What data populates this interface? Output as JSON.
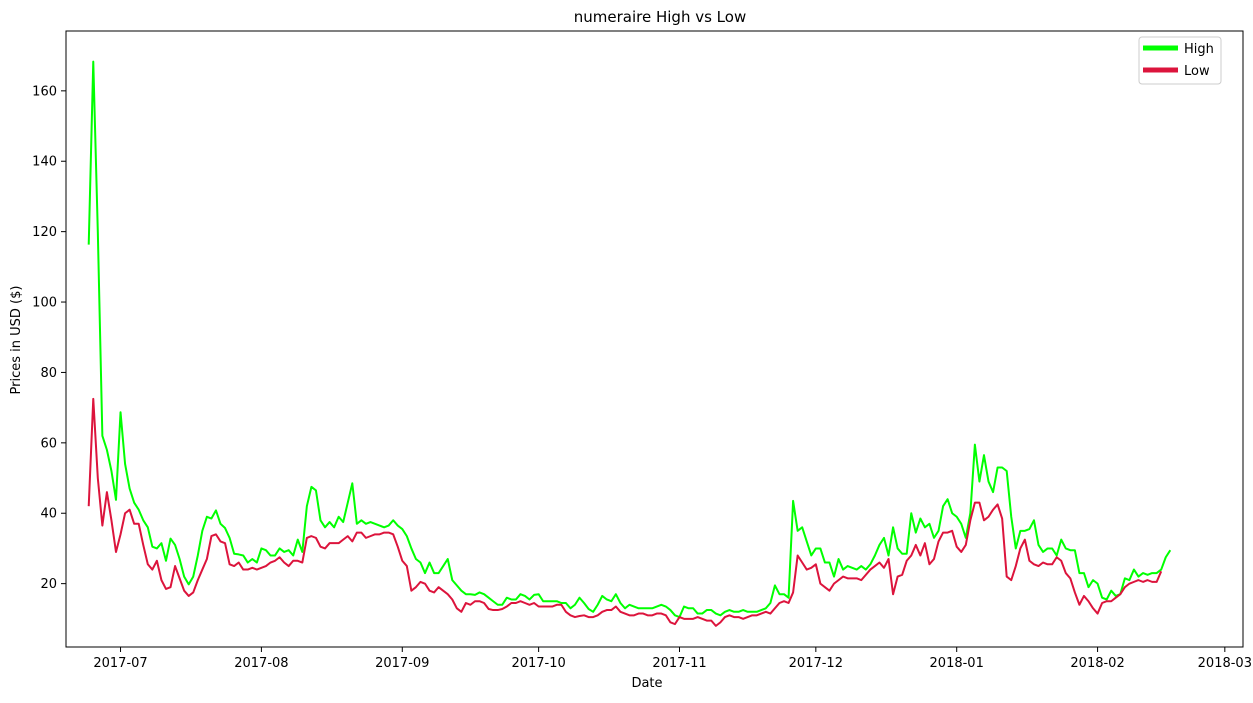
{
  "chart_data": {
    "type": "line",
    "title": "numeraire High vs Low",
    "xlabel": "Date",
    "ylabel": "Prices in USD ($)",
    "xlim": [
      "2017-06-19",
      "2018-03-05"
    ],
    "ylim": [
      2,
      177
    ],
    "x_ticks": [
      "2017-07-01",
      "2017-08-01",
      "2017-09-01",
      "2017-10-01",
      "2017-11-01",
      "2017-12-01",
      "2018-01-01",
      "2018-02-01",
      "2018-03-01"
    ],
    "x_tick_labels": [
      "2017-07",
      "2017-08",
      "2017-09",
      "2017-10",
      "2017-11",
      "2017-12",
      "2018-01",
      "2018-02",
      "2018-03"
    ],
    "y_ticks": [
      20,
      40,
      60,
      80,
      100,
      120,
      140,
      160
    ],
    "grid": false,
    "legend_position": "top-right",
    "x_start": "2017-06-24",
    "x_step_days": 1,
    "series": [
      {
        "name": "High",
        "color": "#00ff00",
        "values": [
          116.3,
          168.3,
          120.0,
          62.0,
          58.0,
          52.0,
          43.8,
          68.7,
          54.0,
          47.0,
          43.0,
          41.0,
          38.0,
          36.0,
          30.5,
          30.0,
          31.5,
          26.5,
          32.8,
          31.0,
          27.0,
          22.0,
          19.8,
          22.0,
          28.0,
          35.0,
          39.0,
          38.5,
          40.8,
          37.0,
          35.8,
          33.0,
          28.5,
          28.3,
          28.0,
          26.0,
          27.0,
          26.0,
          30.0,
          29.5,
          28.0,
          28.0,
          30.0,
          29.0,
          29.5,
          28.0,
          32.5,
          29.0,
          42.0,
          47.5,
          46.5,
          38.0,
          36.0,
          37.5,
          36.0,
          39.0,
          37.5,
          43.0,
          48.5,
          37.0,
          38.0,
          37.0,
          37.5,
          37.0,
          36.5,
          36.0,
          36.5,
          38.0,
          36.5,
          35.5,
          33.5,
          30.0,
          27.0,
          26.0,
          23.0,
          26.0,
          23.0,
          23.0,
          25.0,
          27.0,
          21.0,
          19.5,
          18.0,
          17.0,
          17.0,
          16.8,
          17.5,
          17.0,
          16.0,
          15.0,
          14.0,
          14.0,
          16.0,
          15.5,
          15.5,
          17.0,
          16.5,
          15.5,
          16.8,
          17.0,
          15.0,
          15.0,
          15.0,
          15.0,
          14.5,
          14.5,
          13.0,
          14.0,
          16.0,
          14.5,
          12.8,
          12.0,
          14.0,
          16.5,
          15.5,
          15.0,
          17.0,
          14.5,
          13.0,
          14.0,
          13.5,
          13.0,
          13.0,
          13.0,
          13.0,
          13.5,
          14.0,
          13.5,
          12.5,
          11.0,
          10.5,
          13.5,
          13.0,
          13.0,
          11.5,
          11.5,
          12.5,
          12.5,
          11.5,
          11.0,
          12.0,
          12.5,
          12.0,
          12.0,
          12.5,
          12.0,
          12.0,
          12.0,
          12.5,
          13.0,
          14.5,
          19.5,
          17.0,
          17.0,
          16.0,
          43.5,
          35.0,
          36.0,
          32.0,
          28.0,
          30.0,
          30.0,
          26.0,
          26.0,
          22.0,
          27.0,
          24.0,
          25.0,
          24.5,
          24.0,
          25.0,
          24.0,
          25.5,
          28.0,
          31.0,
          33.0,
          28.0,
          36.0,
          30.0,
          28.5,
          28.5,
          40.0,
          34.5,
          38.5,
          36.0,
          37.0,
          33.0,
          35.0,
          42.0,
          44.0,
          40.0,
          39.0,
          37.0,
          33.0,
          40.0,
          59.5,
          49.0,
          56.5,
          49.0,
          46.0,
          53.0,
          53.0,
          52.0,
          39.0,
          30.0,
          35.0,
          35.0,
          35.5,
          38.0,
          31.0,
          29.0,
          30.0,
          30.0,
          28.0,
          32.5,
          30.0,
          29.5,
          29.5,
          23.0,
          23.0,
          19.0,
          21.0,
          20.0,
          16.0,
          15.5,
          18.0,
          16.5,
          17.0,
          21.5,
          21.0,
          24.0,
          22.0,
          23.0,
          22.5,
          23.0,
          23.0,
          24.0,
          27.5,
          29.5
        ]
      },
      {
        "name": "Low",
        "color": "#dc143c",
        "values": [
          42.0,
          72.5,
          50.0,
          36.5,
          46.0,
          38.0,
          29.0,
          34.0,
          40.0,
          41.0,
          37.0,
          37.0,
          31.0,
          25.5,
          24.0,
          26.5,
          21.0,
          18.5,
          19.0,
          25.0,
          21.5,
          18.0,
          16.5,
          17.5,
          21.0,
          24.0,
          27.0,
          33.5,
          34.0,
          32.0,
          31.5,
          25.5,
          25.0,
          26.0,
          24.0,
          24.0,
          24.5,
          24.0,
          24.5,
          25.0,
          26.0,
          26.5,
          27.5,
          26.0,
          25.0,
          26.5,
          26.5,
          26.0,
          33.0,
          33.5,
          33.0,
          30.5,
          30.0,
          31.5,
          31.5,
          31.5,
          32.5,
          33.5,
          32.0,
          34.5,
          34.5,
          33.0,
          33.5,
          34.0,
          34.0,
          34.5,
          34.5,
          34.0,
          30.5,
          26.5,
          25.0,
          18.0,
          19.0,
          20.5,
          20.0,
          18.0,
          17.5,
          19.0,
          18.0,
          17.0,
          15.5,
          13.0,
          12.0,
          14.5,
          14.0,
          15.0,
          15.0,
          14.5,
          12.8,
          12.5,
          12.5,
          12.8,
          13.5,
          14.5,
          14.5,
          15.0,
          14.5,
          14.0,
          14.5,
          13.5,
          13.5,
          13.5,
          13.5,
          14.0,
          14.0,
          12.0,
          11.0,
          10.5,
          10.8,
          11.0,
          10.5,
          10.5,
          11.0,
          12.0,
          12.5,
          12.5,
          13.5,
          12.0,
          11.5,
          11.0,
          11.0,
          11.5,
          11.5,
          11.0,
          11.0,
          11.5,
          11.5,
          11.0,
          9.0,
          8.5,
          10.5,
          10.0,
          10.0,
          10.0,
          10.5,
          10.0,
          9.5,
          9.5,
          8.0,
          9.0,
          10.5,
          11.0,
          10.5,
          10.5,
          10.0,
          10.5,
          11.0,
          11.0,
          11.5,
          12.0,
          11.5,
          13.0,
          14.5,
          15.0,
          14.5,
          17.5,
          28.0,
          26.0,
          24.0,
          24.5,
          25.5,
          20.0,
          19.0,
          18.0,
          20.0,
          21.0,
          22.0,
          21.5,
          21.5,
          21.5,
          21.0,
          22.5,
          24.0,
          25.0,
          26.0,
          24.5,
          27.0,
          17.0,
          22.0,
          22.5,
          26.5,
          28.0,
          31.0,
          28.0,
          31.5,
          25.5,
          27.0,
          32.0,
          34.5,
          34.5,
          35.0,
          30.5,
          29.0,
          31.0,
          38.0,
          43.0,
          43.0,
          38.0,
          39.0,
          41.0,
          42.5,
          38.5,
          22.0,
          21.0,
          25.0,
          30.0,
          32.5,
          26.5,
          25.5,
          25.0,
          26.0,
          25.5,
          25.5,
          27.5,
          26.5,
          23.0,
          21.5,
          17.5,
          14.0,
          16.5,
          15.0,
          13.0,
          11.5,
          14.5,
          15.0,
          15.0,
          16.0,
          17.0,
          19.0,
          20.0,
          20.5,
          21.0,
          20.5,
          21.0,
          20.5,
          20.5,
          23.5
        ]
      }
    ]
  }
}
